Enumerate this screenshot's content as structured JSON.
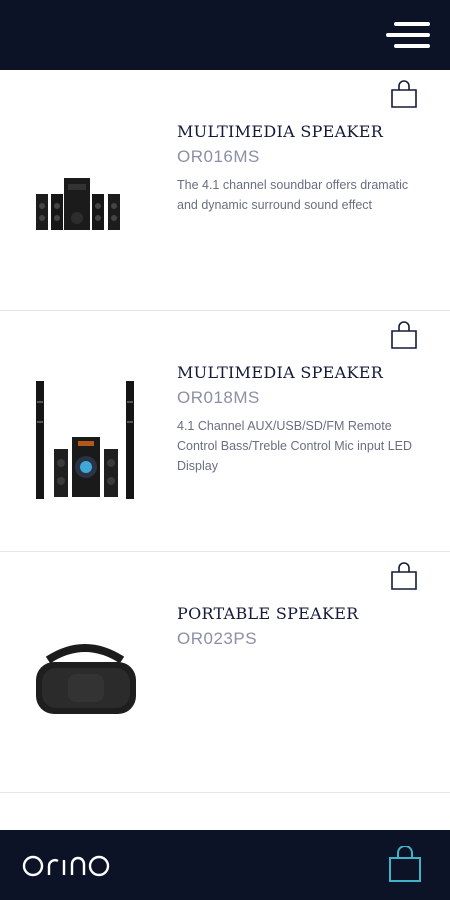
{
  "header": {
    "menu_icon": "menu-icon"
  },
  "products": [
    {
      "title": "MULTIMEDIA SPEAKER",
      "code": "OR016MS",
      "description": "The 4.1 channel soundbar offers dramatic and dynamic surround sound effect",
      "image": "speaker-set-image"
    },
    {
      "title": "MULTIMEDIA SPEAKER",
      "code": "OR018MS",
      "description": "4.1 Channel AUX/USB/SD/FM Remote Control Bass/Treble Control Mic input LED Display",
      "image": "tower-speaker-set-image"
    },
    {
      "title": "PORTABLE SPEAKER",
      "code": "OR023PS",
      "description": "",
      "image": "portable-speaker-image"
    }
  ],
  "footer": {
    "logo_text": "orino",
    "cart_icon": "shopping-bag-icon"
  },
  "colors": {
    "bar": "#0d1327",
    "accent": "#3fb3c8",
    "title": "#141a3a",
    "code": "#8c90a6",
    "desc": "#6a6e82"
  }
}
